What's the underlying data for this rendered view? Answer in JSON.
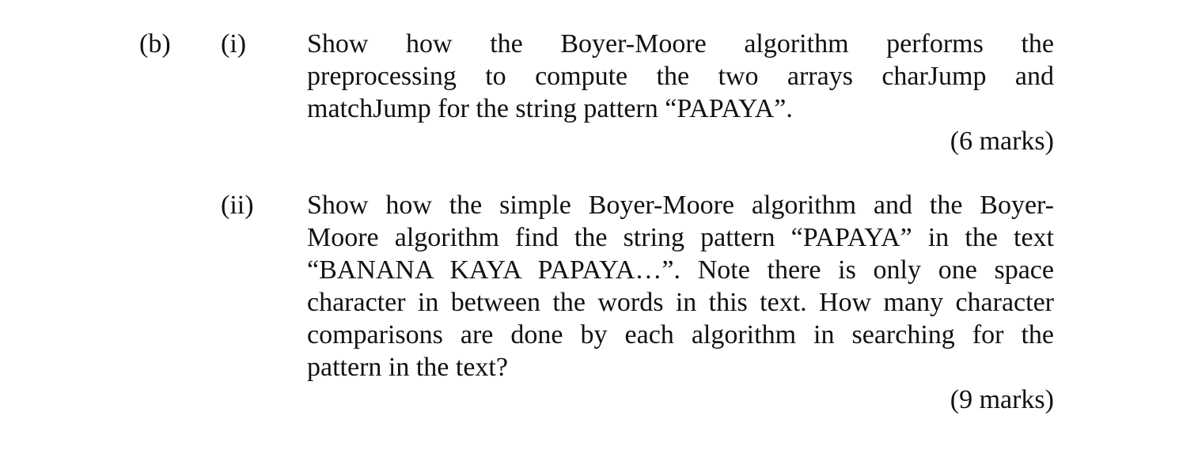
{
  "question": {
    "part_label": "(b)",
    "subparts": [
      {
        "label": "(i)",
        "lines": [
          "Show how the Boyer-Moore algorithm performs the",
          "preprocessing to compute the two arrays charJump and",
          "matchJump for the string pattern “PAPAYA”."
        ],
        "marks": "(6 marks)"
      },
      {
        "label": "(ii)",
        "lines": [
          "Show how the simple Boyer-Moore algorithm and the Boyer-",
          "Moore algorithm find the string pattern “PAPAYA” in the text",
          "“BANANA KAYA PAPAYA…”.  Note there is only one space",
          "character in between the words in this text.  How many character",
          "comparisons are done by each algorithm in searching for the",
          "pattern in the text?"
        ],
        "marks": "(9 marks)"
      }
    ]
  }
}
